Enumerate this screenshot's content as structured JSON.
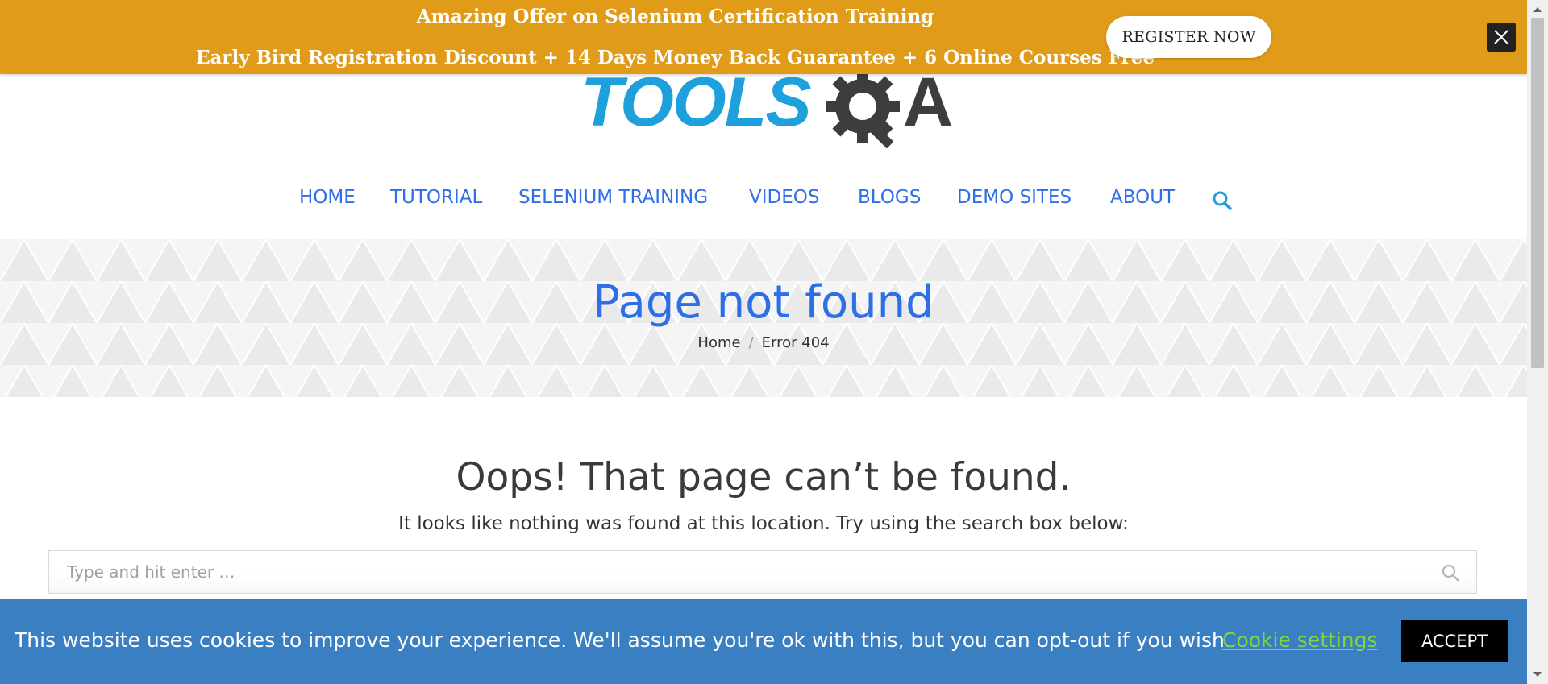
{
  "promo": {
    "headline": "Amazing Offer on Selenium Certification Training",
    "subline": "Early Bird Registration Discount + 14 Days Money Back Guarantee + 6 Online Courses Free",
    "register_label": "REGISTER NOW",
    "close_icon": "close-icon",
    "background_color": "#e09c18"
  },
  "logo": {
    "text_left": "TOOLS",
    "text_right": "A",
    "colors": {
      "tools": "#1ea0dc",
      "qa": "#3d3d3d"
    }
  },
  "nav": {
    "items": [
      {
        "label": "HOME"
      },
      {
        "label": "TUTORIAL"
      },
      {
        "label": "SELENIUM TRAINING"
      },
      {
        "label": "VIDEOS"
      },
      {
        "label": "BLOGS"
      },
      {
        "label": "DEMO SITES"
      },
      {
        "label": "ABOUT"
      }
    ],
    "search_icon": "search-icon",
    "link_color": "#2e6fe6"
  },
  "hero": {
    "title": "Page not found",
    "breadcrumb": {
      "home": "Home",
      "separator": "/",
      "current": "Error 404"
    }
  },
  "main": {
    "heading": "Oops! That page can’t be found.",
    "subtext": "It looks like nothing was found at this location. Try using the search box below:",
    "search": {
      "placeholder": "Type and hit enter …",
      "value": ""
    }
  },
  "cookie": {
    "message": "This website uses cookies to improve your experience. We'll assume you're ok with this, but you can opt-out if you wish.",
    "settings_label": "Cookie settings",
    "accept_label": "ACCEPT",
    "background_color": "#3a7fc1"
  }
}
